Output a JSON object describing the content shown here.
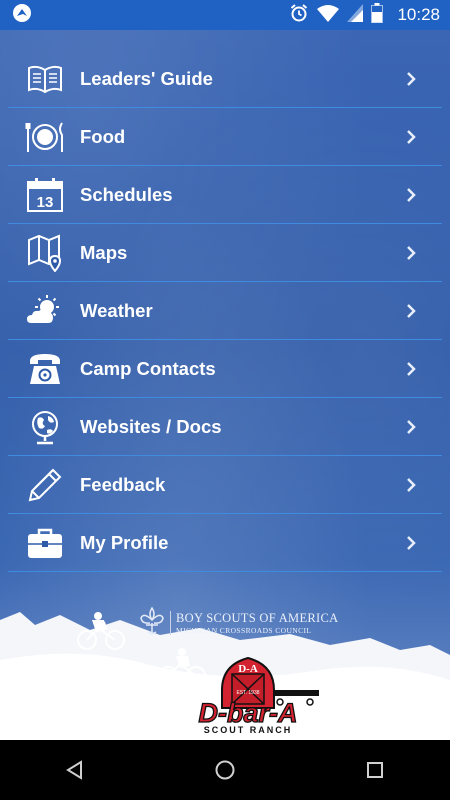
{
  "status_bar": {
    "time": "10:28",
    "icons": [
      "app-notification-icon",
      "alarm-icon",
      "wifi-icon",
      "signal-icon",
      "battery-icon"
    ]
  },
  "menu": {
    "items": [
      {
        "label": "Leaders' Guide",
        "icon": "book-icon"
      },
      {
        "label": "Food",
        "icon": "plate-icon"
      },
      {
        "label": "Schedules",
        "icon": "calendar-icon",
        "calendar_day": "13"
      },
      {
        "label": "Maps",
        "icon": "map-icon"
      },
      {
        "label": "Weather",
        "icon": "weather-icon"
      },
      {
        "label": "Camp Contacts",
        "icon": "phone-icon"
      },
      {
        "label": "Websites / Docs",
        "icon": "globe-icon"
      },
      {
        "label": "Feedback",
        "icon": "pencil-icon"
      },
      {
        "label": "My Profile",
        "icon": "briefcase-icon"
      }
    ]
  },
  "footer": {
    "bsa_line1": "BOY SCOUTS OF AMERICA",
    "bsa_line2": "MICHIGAN CROSSROADS COUNCIL",
    "logo_name": "D-bar-A",
    "logo_sub": "SCOUT RANCH",
    "logo_barn_text": "D-A",
    "logo_barn_small": "EST. 1938"
  },
  "colors": {
    "status_bar": "#1f62c4",
    "background": "#3b66b4",
    "divider": "#3f8be0",
    "logo_red": "#d32330"
  }
}
